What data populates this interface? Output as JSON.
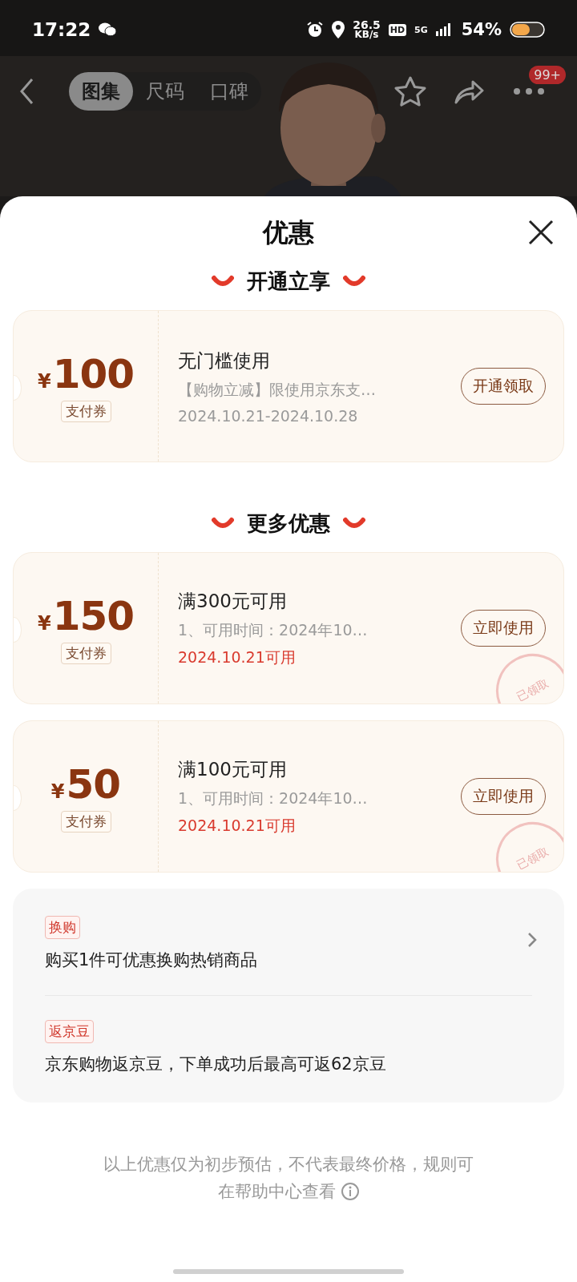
{
  "status_bar": {
    "time": "17:22",
    "net_speed_value": "26.5",
    "net_speed_unit": "KB/s",
    "hd": "HD",
    "network": "5G",
    "battery": "54%"
  },
  "nav": {
    "tabs": [
      {
        "label": "图集",
        "selected": true
      },
      {
        "label": "尺码",
        "selected": false
      },
      {
        "label": "口碑",
        "selected": false
      }
    ],
    "badge": "99+"
  },
  "sheet": {
    "title": "优惠",
    "sections": [
      {
        "heading": "开通立享",
        "coupons": [
          {
            "currency": "¥",
            "amount": "100",
            "tag": "支付券",
            "title": "无门槛使用",
            "description": "【购物立减】限使用京东支…",
            "date": "2024.10.21-2024.10.28",
            "date_highlight": false,
            "button": "开通领取",
            "claimed": false
          }
        ]
      },
      {
        "heading": "更多优惠",
        "coupons": [
          {
            "currency": "¥",
            "amount": "150",
            "tag": "支付券",
            "title": "满300元可用",
            "description": "1、可用时间：2024年10…",
            "date": "2024.10.21可用",
            "date_highlight": true,
            "button": "立即使用",
            "claimed": true,
            "stamp": "已领取"
          },
          {
            "currency": "¥",
            "amount": "50",
            "tag": "支付券",
            "title": "满100元可用",
            "description": "1、可用时间：2024年10…",
            "date": "2024.10.21可用",
            "date_highlight": true,
            "button": "立即使用",
            "claimed": true,
            "stamp": "已领取"
          }
        ]
      }
    ],
    "offers": [
      {
        "tag": "换购",
        "text": "购买1件可优惠换购热销商品",
        "has_arrow": true
      },
      {
        "tag": "返京豆",
        "text": "京东购物返京豆，下单成功后最高可返62京豆",
        "has_arrow": false
      }
    ],
    "footer_lines": [
      "以上优惠仅为初步预估，不代表最终价格，规则可",
      "在帮助中心查看"
    ]
  }
}
